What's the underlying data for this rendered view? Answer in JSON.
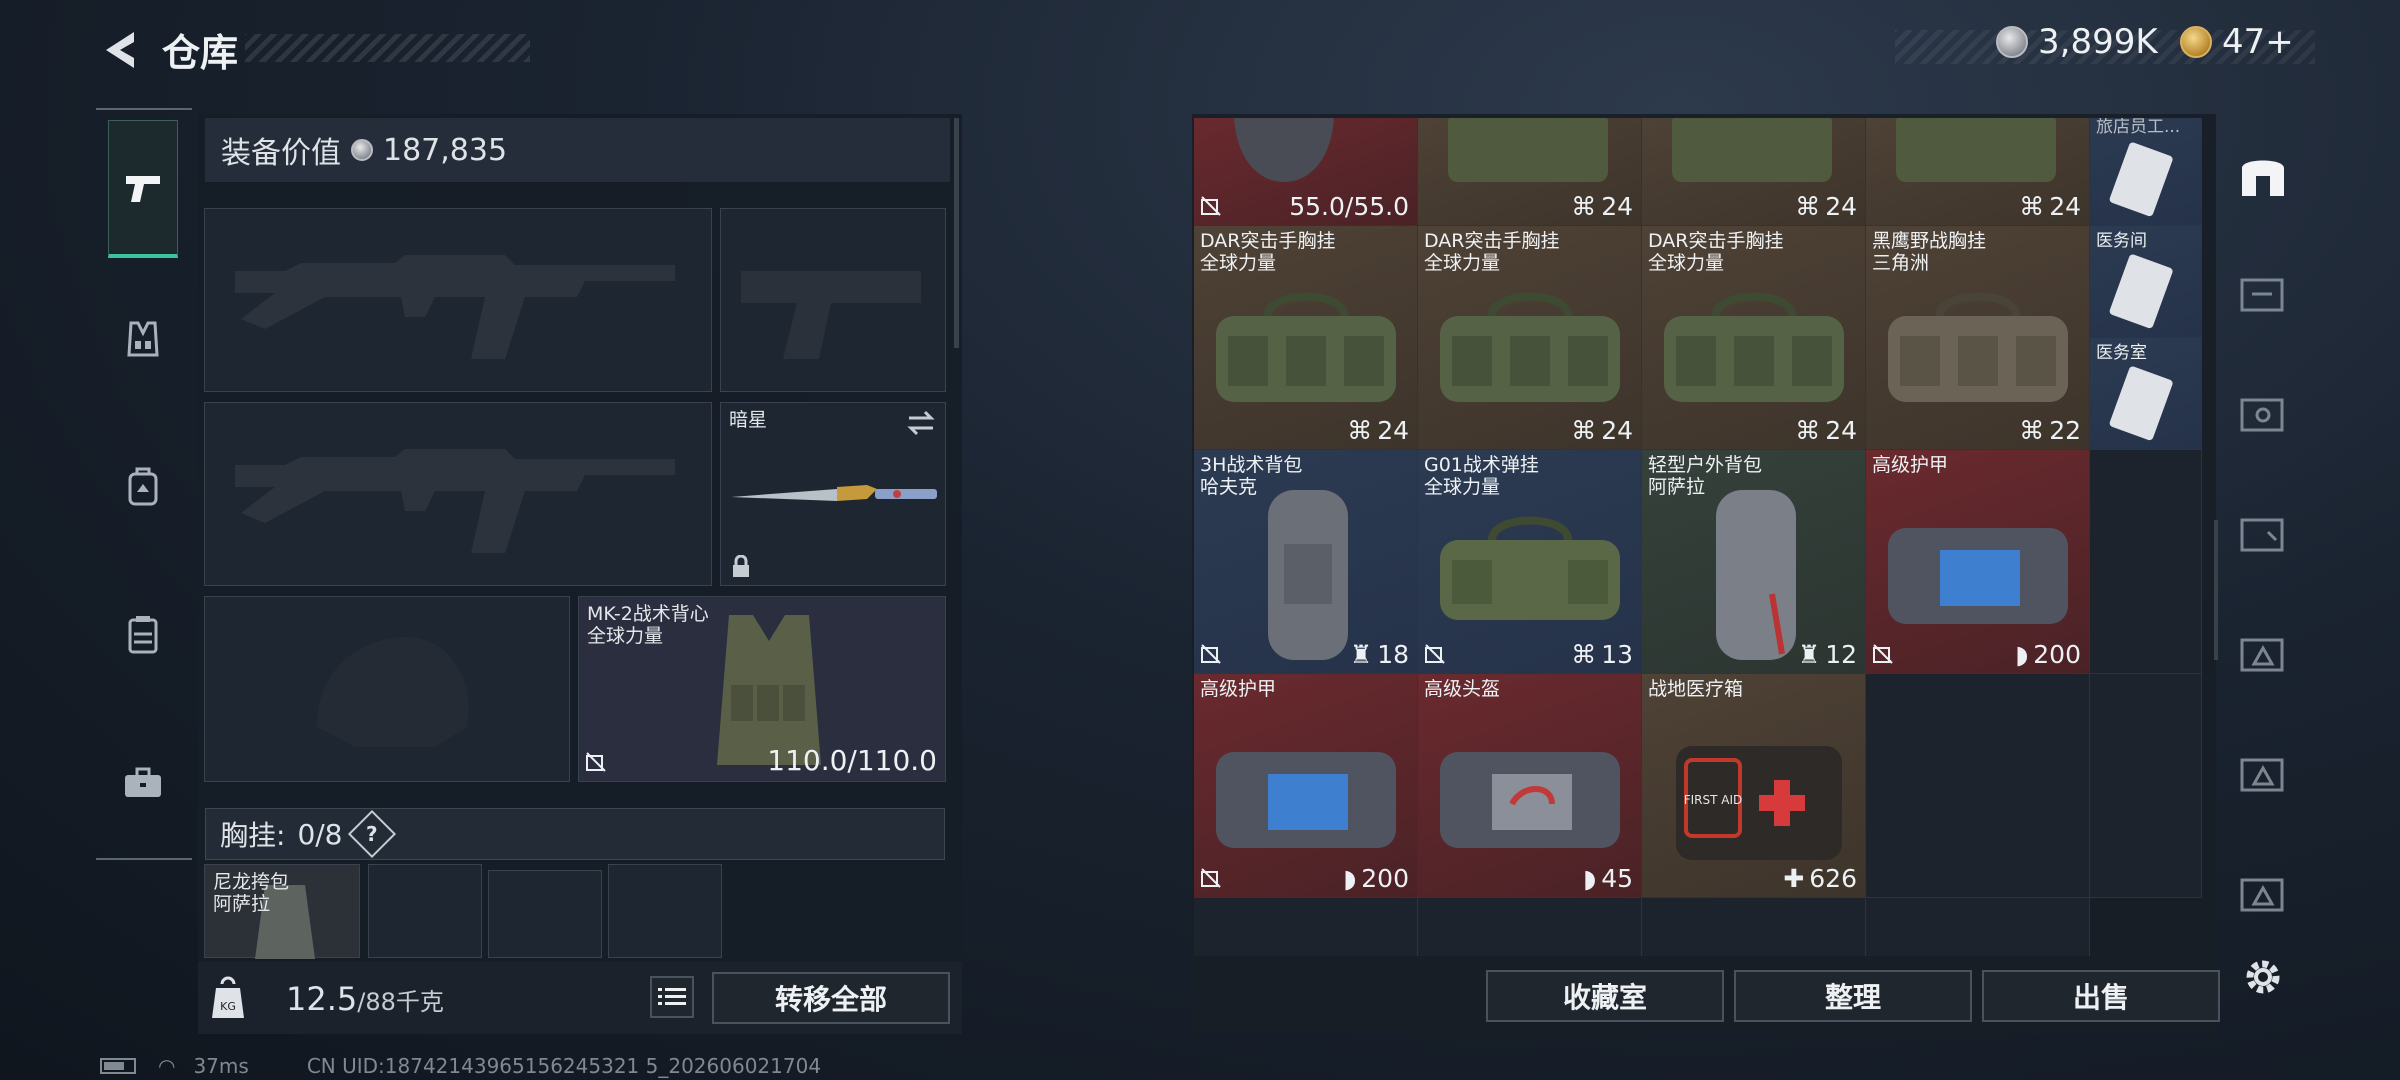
{
  "header": {
    "title": "仓库",
    "currency_silver": "3,899K",
    "currency_gold": "47+"
  },
  "left_tabs": [
    "weapons-icon",
    "armor-icon",
    "backpack-icon",
    "chest-rig-icon",
    "toolbox-icon"
  ],
  "equipment": {
    "value_label": "装备价值",
    "value": "187,835",
    "melee_name": "暗星",
    "armor_name": "MK-2战术背心",
    "armor_brand": "全球力量",
    "armor_durability": "110.0/110.0",
    "chest_label": "胸挂:",
    "chest_count": "0/8",
    "chest_help": "?",
    "pouch_name": "尼龙挎包",
    "pouch_brand": "阿萨拉",
    "weight_current": "12.5",
    "weight_max": "/88千克",
    "transfer_all": "转移全部"
  },
  "storage": {
    "row0": [
      {
        "value": "55.0/55.0",
        "icon": "no-sell"
      },
      {
        "value": "24",
        "icon": "vest"
      },
      {
        "value": "24",
        "icon": "vest"
      },
      {
        "value": "24",
        "icon": "vest"
      }
    ],
    "side_items": [
      {
        "label": "旅店员工..."
      },
      {
        "label": "医务间"
      },
      {
        "label": "医务室"
      }
    ],
    "row1": [
      {
        "name": "DAR突击手胸挂",
        "brand": "全球力量",
        "value": "24"
      },
      {
        "name": "DAR突击手胸挂",
        "brand": "全球力量",
        "value": "24"
      },
      {
        "name": "DAR突击手胸挂",
        "brand": "全球力量",
        "value": "24"
      },
      {
        "name": "黑鹰野战胸挂",
        "brand": "三角洲",
        "value": "22"
      }
    ],
    "row2": [
      {
        "name": "3H战术背包",
        "brand": "哈夫克",
        "value": "18"
      },
      {
        "name": "G01战术弹挂",
        "brand": "全球力量",
        "value": "13"
      },
      {
        "name": "轻型户外背包",
        "brand": "阿萨拉",
        "value": "12"
      },
      {
        "name": "高级护甲",
        "brand": "",
        "value": "200"
      }
    ],
    "row3": [
      {
        "name": "高级护甲",
        "value": "200"
      },
      {
        "name": "高级头盔",
        "value": "45"
      },
      {
        "name": "战地医疗箱",
        "value": "626",
        "box_text": "FIRST AID"
      }
    ],
    "buttons": {
      "collection": "收藏室",
      "organize": "整理",
      "sell": "出售"
    }
  },
  "status_bar": {
    "ping": "37ms",
    "uid": "CN UID:18742143965156245321 5_202606021704"
  }
}
